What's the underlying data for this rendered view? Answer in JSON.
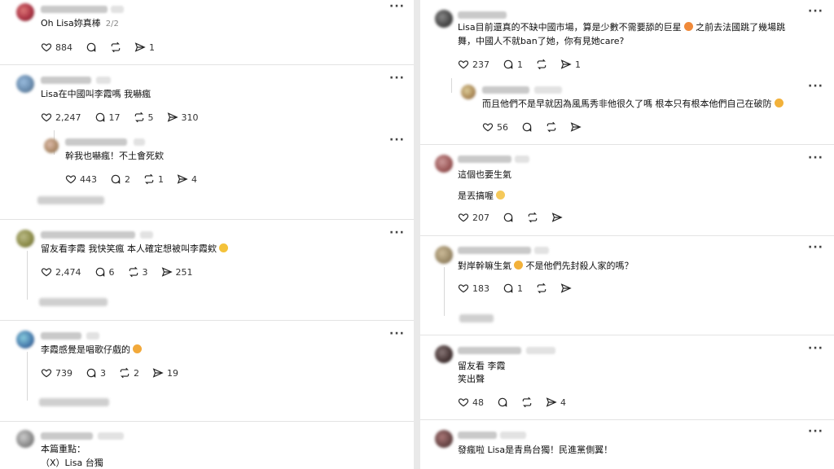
{
  "left": [
    {
      "text": "Oh Lisa妳真棒",
      "page": "2/2",
      "likes": "884",
      "replies": "",
      "reposts": "",
      "shares": "1"
    },
    {
      "text": "Lisa在中國叫李霞嗎 我嚇瘋",
      "likes": "2,247",
      "replies": "17",
      "reposts": "5",
      "shares": "310",
      "reply": {
        "text": "幹我也嚇瘋！不土會死欸",
        "likes": "443",
        "replies": "2",
        "reposts": "1",
        "shares": "4"
      }
    },
    {
      "text": "留友看李霞 我快笑瘋 本人確定想被叫李霞欸",
      "likes": "2,474",
      "replies": "6",
      "reposts": "3",
      "shares": "251"
    },
    {
      "text": "李霞感覺是唱歌仔戲的",
      "likes": "739",
      "replies": "3",
      "reposts": "2",
      "shares": "19"
    },
    {
      "text1": "本篇重點：",
      "text2": "（X）Lisa 台獨"
    }
  ],
  "right": [
    {
      "text1": "Lisa目前還真的不缺中國市場，算是少數不需要舔的巨星",
      "text1b": " 之前去法國跳了幾場跳",
      "text2": "舞，中國人不就ban了她，你有見她care?",
      "likes": "237",
      "replies": "1",
      "reposts": "",
      "shares": "1",
      "reply": {
        "text": "而且他們不是早就因為風馬秀非他很久了嗎 根本只有根本他們自己在破防",
        "likes": "56",
        "replies": "",
        "reposts": "",
        "shares": ""
      }
    },
    {
      "text1": "這個也要生氣",
      "text2": "是丟搞喔",
      "likes": "207",
      "replies": "",
      "reposts": "",
      "shares": ""
    },
    {
      "text": "對岸幹嘛生氣",
      "text_b": " 不是他們先封殺人家的嗎？",
      "likes": "183",
      "replies": "1",
      "reposts": "",
      "shares": ""
    },
    {
      "text1": "留友看 李霞",
      "text2": "笑出聲",
      "likes": "48",
      "replies": "",
      "reposts": "",
      "shares": "4"
    },
    {
      "text": "發瘋啦 Lisa是青鳥台獨！民進黨側翼！"
    }
  ],
  "icons": {
    "like": "heart-icon",
    "reply": "comment-icon",
    "repost": "repost-icon",
    "share": "share-icon",
    "more": "more-icon"
  },
  "more_label": "···"
}
